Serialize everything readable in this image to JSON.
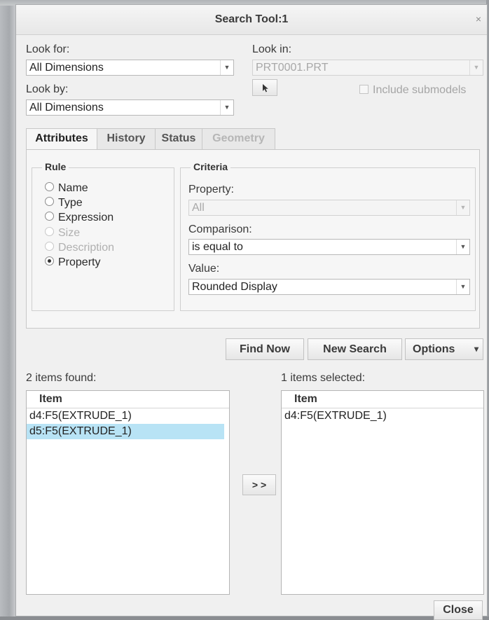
{
  "window": {
    "title": "Search Tool:1",
    "close_glyph": "×"
  },
  "look_for": {
    "label": "Look for:",
    "value": "All Dimensions"
  },
  "look_by": {
    "label": "Look by:",
    "value": "All Dimensions"
  },
  "look_in": {
    "label": "Look in:",
    "value": "PRT0001.PRT",
    "include_submodels": "Include submodels"
  },
  "tabs": [
    {
      "label": "Attributes",
      "state": "active"
    },
    {
      "label": "History",
      "state": "normal"
    },
    {
      "label": "Status",
      "state": "normal"
    },
    {
      "label": "Geometry",
      "state": "disabled"
    }
  ],
  "rule": {
    "legend": "Rule",
    "options": [
      {
        "label": "Name",
        "enabled": true,
        "selected": false
      },
      {
        "label": "Type",
        "enabled": true,
        "selected": false
      },
      {
        "label": "Expression",
        "enabled": true,
        "selected": false
      },
      {
        "label": "Size",
        "enabled": false,
        "selected": false
      },
      {
        "label": "Description",
        "enabled": false,
        "selected": false
      },
      {
        "label": "Property",
        "enabled": true,
        "selected": true
      }
    ]
  },
  "criteria": {
    "legend": "Criteria",
    "property_label": "Property:",
    "property_value": "All",
    "comparison_label": "Comparison:",
    "comparison_value": "is equal to",
    "value_label": "Value:",
    "value_value": "Rounded Display"
  },
  "buttons": {
    "find_now": "Find Now",
    "new_search": "New Search",
    "options": "Options",
    "options_arrow": "▾",
    "move": "> >",
    "close": "Close"
  },
  "found": {
    "summary": "2 items found:",
    "column": "Item",
    "items": [
      "d4:F5(EXTRUDE_1)",
      "d5:F5(EXTRUDE_1)"
    ],
    "highlighted_index": 1
  },
  "selected": {
    "summary": "1 items selected:",
    "column": "Item",
    "items": [
      "d4:F5(EXTRUDE_1)"
    ]
  },
  "icons": {
    "dropdown": "chevron-down-icon",
    "pick": "select-arrow-icon",
    "close": "close-icon"
  }
}
